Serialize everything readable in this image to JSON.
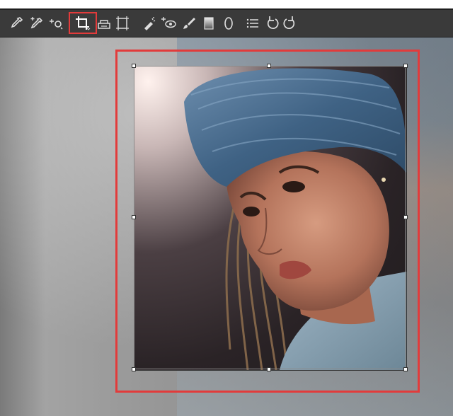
{
  "toolbar": {
    "tools": [
      {
        "name": "eyedropper-icon",
        "selected": false
      },
      {
        "name": "color-sampler-icon",
        "selected": false
      },
      {
        "name": "targeted-adjustment-icon",
        "selected": false
      },
      {
        "name": "crop-icon",
        "selected": true
      },
      {
        "name": "straighten-icon",
        "selected": false
      },
      {
        "name": "transform-icon",
        "selected": false
      },
      {
        "name": "spot-removal-icon",
        "selected": false
      },
      {
        "name": "red-eye-icon",
        "selected": false
      },
      {
        "name": "adjustment-brush-icon",
        "selected": false
      },
      {
        "name": "graduated-filter-icon",
        "selected": false
      },
      {
        "name": "radial-filter-icon",
        "selected": false
      },
      {
        "name": "preferences-list-icon",
        "selected": false
      },
      {
        "name": "rotate-left-icon",
        "selected": false
      },
      {
        "name": "rotate-right-icon",
        "selected": false
      }
    ]
  },
  "colors": {
    "toolbar_bg": "#3a3a3a",
    "icon": "#dddddd",
    "highlight": "#e23b3b",
    "canvas": "#9b9b9b"
  },
  "photo": {
    "subject": "portrait-photo"
  }
}
